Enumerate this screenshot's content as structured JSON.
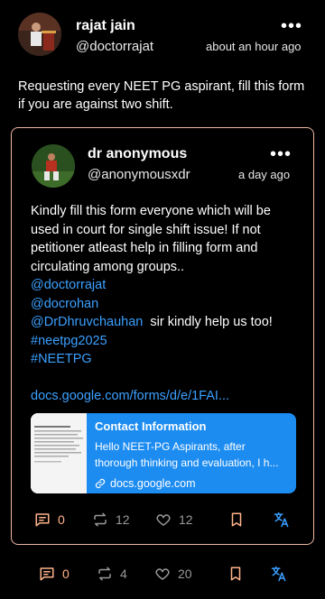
{
  "post": {
    "author_name": "rajat jain",
    "author_handle": "@doctorrajat",
    "time": "about an hour ago",
    "text": "Requesting every NEET PG aspirant, fill this form if you are against two shift.",
    "more_icon": "more-horizontal-icon",
    "actions": {
      "comments": "0",
      "reposts": "4",
      "likes": "20"
    }
  },
  "quote": {
    "author_name": "dr anonymous",
    "author_handle": "@anonymousxdr",
    "time": "a day ago",
    "body_lines": [
      "Kindly fill this form everyone which will be",
      "used in court for single shift issue! If not",
      "petitioner atleast help in filling form and",
      "circulating among groups.."
    ],
    "mention_1": "@doctorrajat",
    "mention_2": "@docrohan",
    "mention_3": "@DrDhruvchauhan",
    "mention_3_suffix": "  sir kindly help us too!",
    "hashtag_1": "#neetpg2025",
    "hashtag_2": "#NEETPG",
    "url": "docs.google.com/forms/d/e/1FAI...",
    "card": {
      "title": "Contact Information",
      "description": "Hello NEET-PG Aspirants, after thorough thinking and evaluation, I h...",
      "domain": "docs.google.com"
    },
    "actions": {
      "comments": "0",
      "reposts": "12",
      "likes": "12"
    }
  },
  "colors": {
    "accent_orange": "#ffb38a",
    "link_blue": "#3ba0ff",
    "card_blue": "#1d8cf0",
    "border": "#f0b8a0"
  }
}
